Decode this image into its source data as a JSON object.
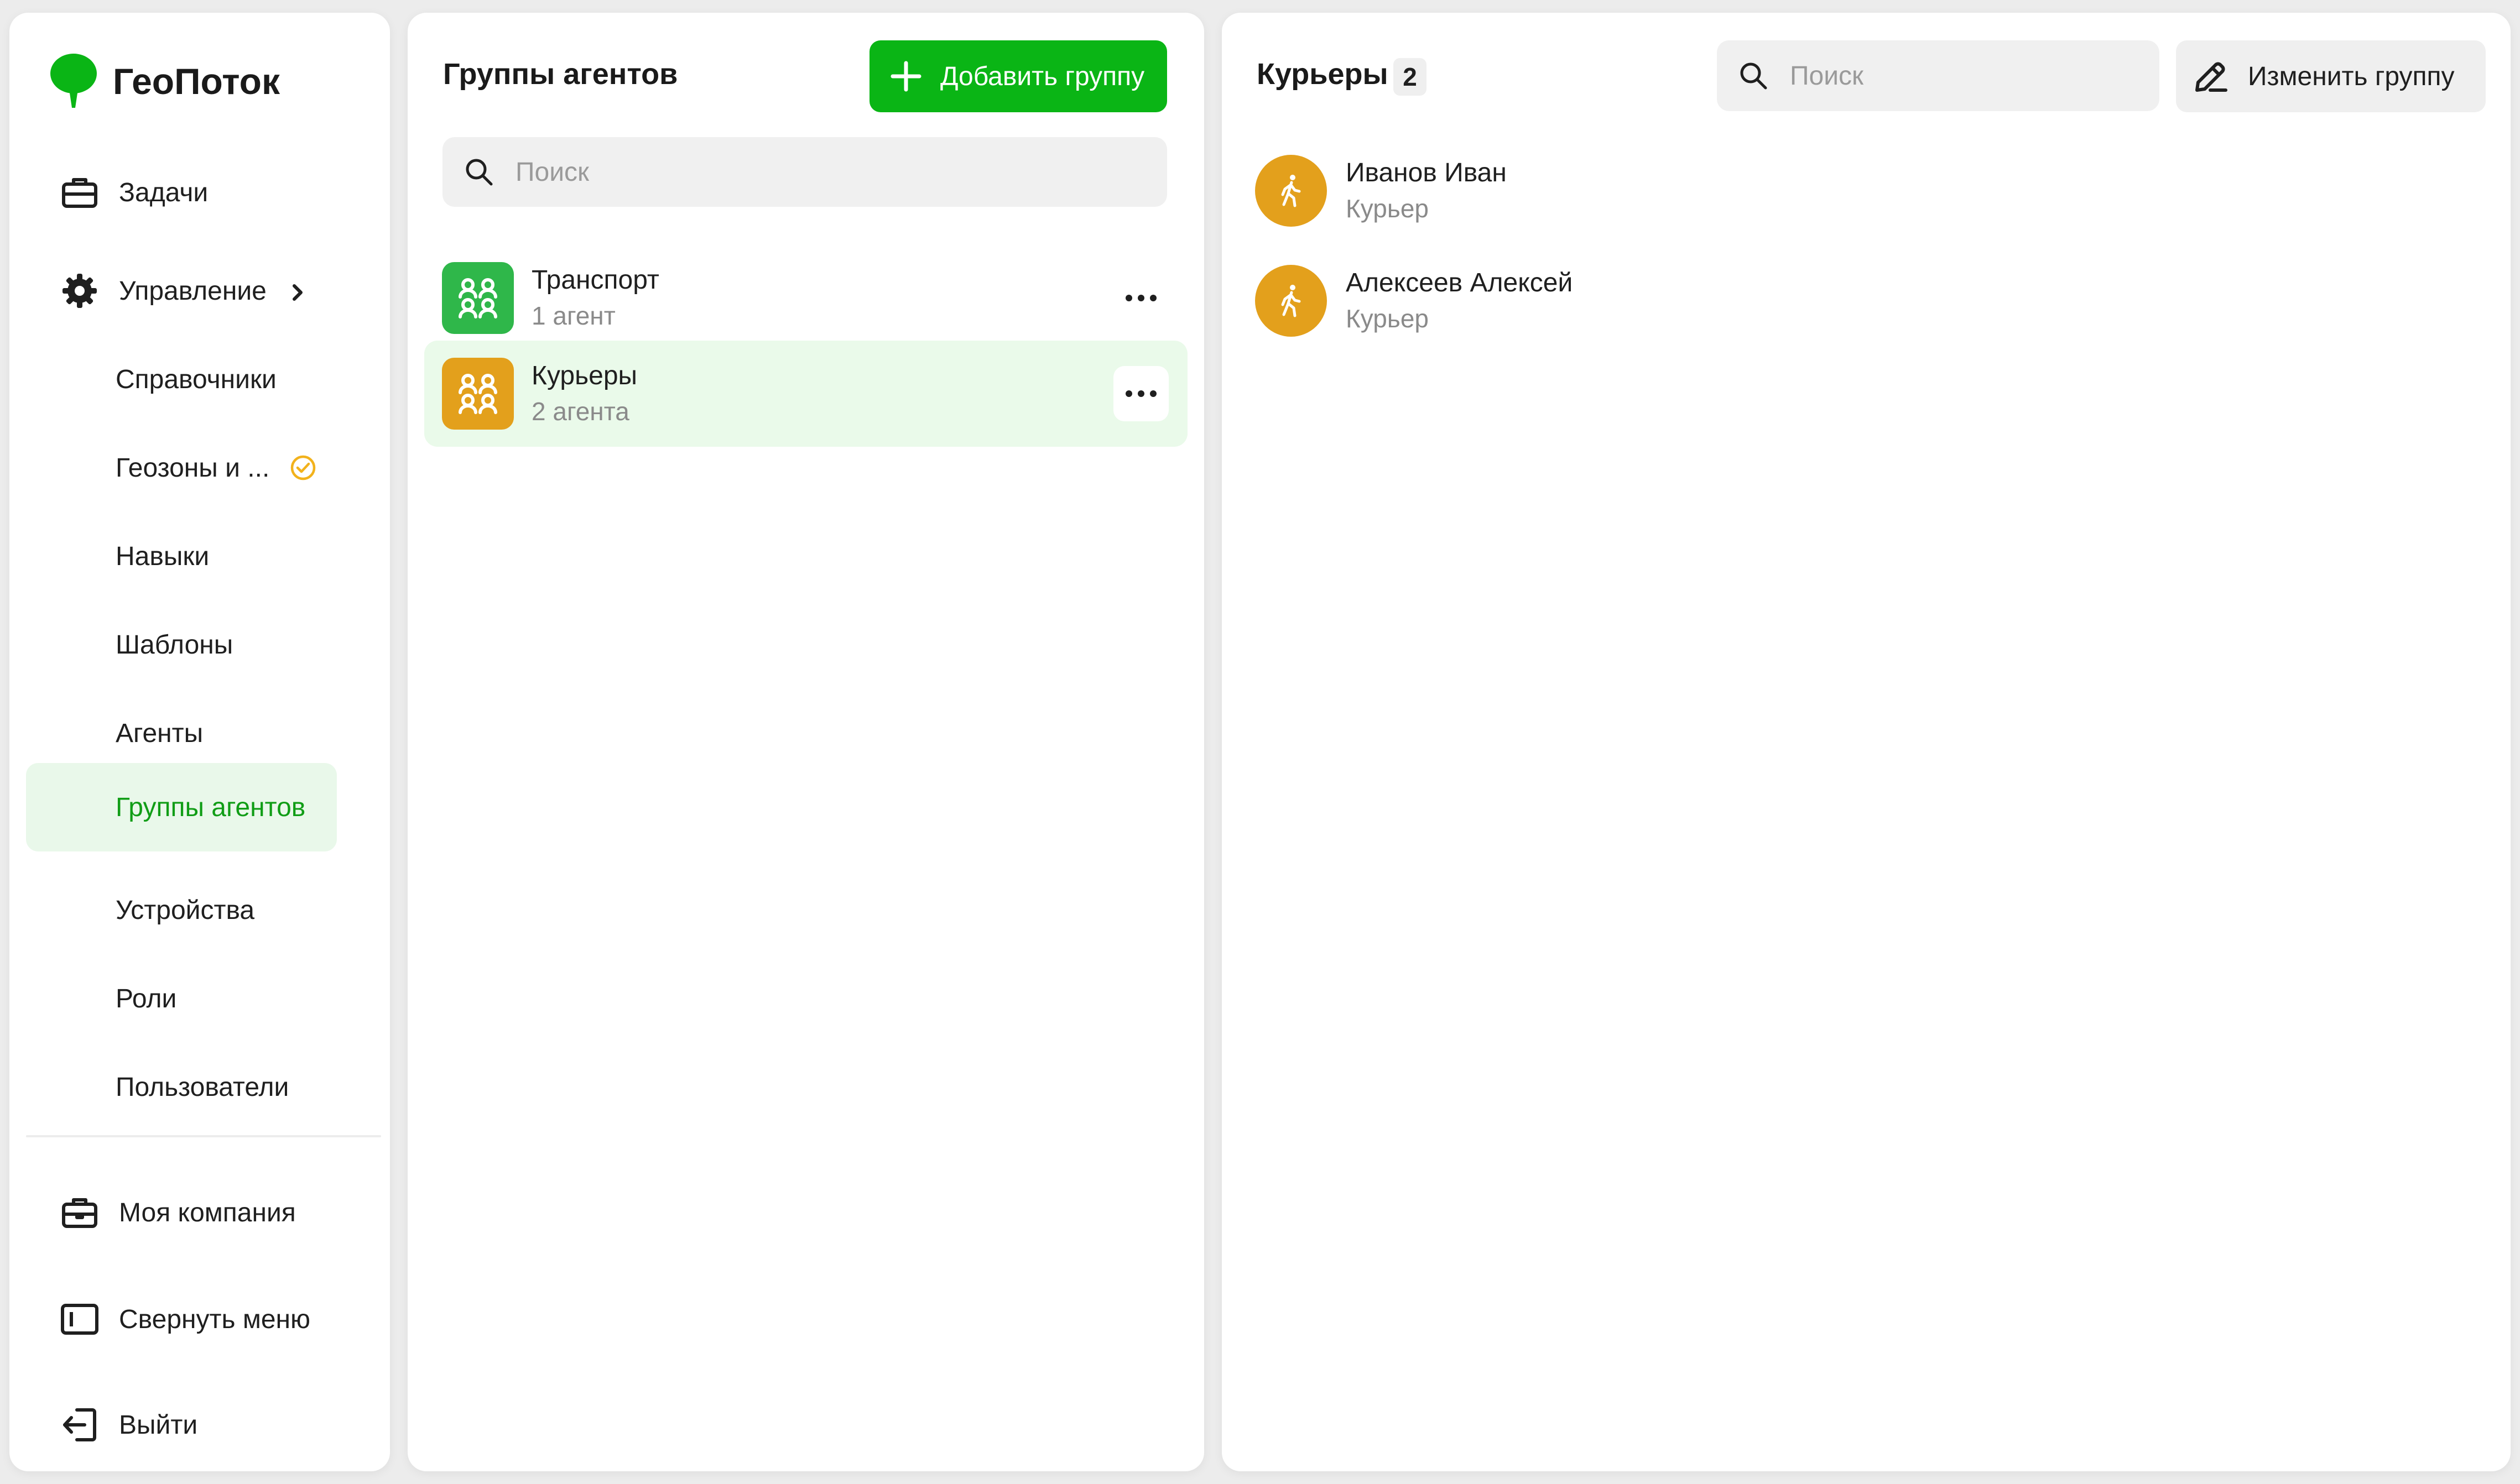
{
  "app": {
    "name": "ГеоПоток"
  },
  "colors": {
    "accent": "#0ab515",
    "accent_light": "#e9f8ea",
    "orange": "#e3a01c",
    "green_group": "#2fb74a"
  },
  "sidebar": {
    "items": [
      {
        "label": "Задачи",
        "icon": "briefcase-icon"
      },
      {
        "label": "Управление",
        "icon": "gear-icon"
      },
      {
        "label": "Справочники"
      },
      {
        "label": "Геозоны и ..."
      },
      {
        "label": "Навыки"
      },
      {
        "label": "Шаблоны"
      },
      {
        "label": "Агенты"
      },
      {
        "label": "Группы агентов",
        "active": true
      },
      {
        "label": "Устройства"
      },
      {
        "label": "Роли"
      },
      {
        "label": "Пользователи"
      }
    ],
    "bottom": [
      {
        "label": "Моя компания",
        "icon": "company-icon"
      },
      {
        "label": "Свернуть меню",
        "icon": "collapse-menu-icon"
      },
      {
        "label": "Выйти",
        "icon": "logout-icon"
      }
    ]
  },
  "groups": {
    "title": "Группы агентов",
    "add_label": "Добавить группу",
    "search_placeholder": "Поиск",
    "items": [
      {
        "name": "Транспорт",
        "count": "1 агент",
        "color": "#2fb74a"
      },
      {
        "name": "Курьеры",
        "count": "2 агента",
        "color": "#e3a01c",
        "active": true
      }
    ]
  },
  "detail": {
    "title": "Курьеры",
    "count": "2",
    "search_placeholder": "Поиск",
    "edit_label": "Изменить группу",
    "agents": [
      {
        "name": "Иванов Иван",
        "role": "Курьер"
      },
      {
        "name": "Алексеев Алексей",
        "role": "Курьер"
      }
    ]
  }
}
